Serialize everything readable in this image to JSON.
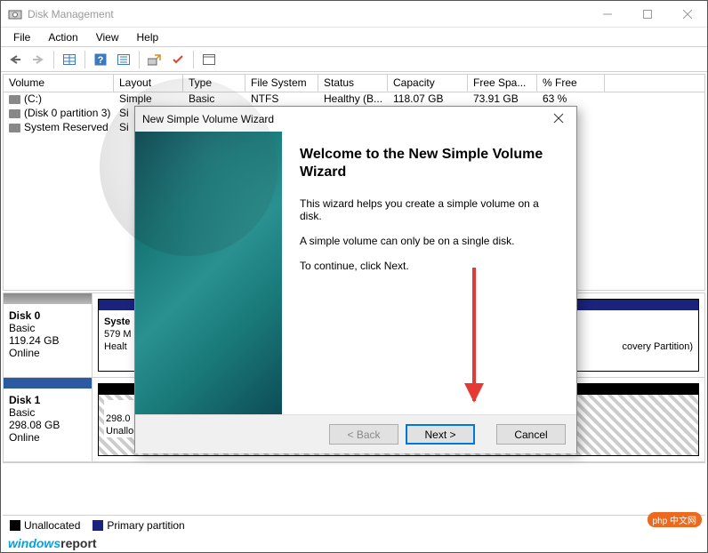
{
  "window": {
    "title": "Disk Management",
    "menus": [
      "File",
      "Action",
      "View",
      "Help"
    ]
  },
  "columns": {
    "volume": "Volume",
    "layout": "Layout",
    "type": "Type",
    "fs": "File System",
    "status": "Status",
    "capacity": "Capacity",
    "free": "Free Spa...",
    "pct": "% Free"
  },
  "volumes": [
    {
      "name": "(C:)",
      "layout": "Simple",
      "type": "Basic",
      "fs": "NTFS",
      "status": "Healthy (B...",
      "cap": "118.07 GB",
      "free": "73.91 GB",
      "pct": "63 %"
    },
    {
      "name": "(Disk 0 partition 3)",
      "layout": "Si",
      "type": "",
      "fs": "",
      "status": "",
      "cap": "",
      "free": "",
      "pct": ""
    },
    {
      "name": "System Reserved",
      "layout": "Si",
      "type": "",
      "fs": "",
      "status": "",
      "cap": "",
      "free": "",
      "pct": ""
    }
  ],
  "disks": [
    {
      "name": "Disk 0",
      "type": "Basic",
      "size": "119.24 GB",
      "state": "Online",
      "parts": [
        {
          "label1": "Syste",
          "label2": "579 M",
          "label3": "Healt"
        },
        {
          "label1": "",
          "label2": "",
          "label3": "covery Partition)"
        }
      ]
    },
    {
      "name": "Disk 1",
      "type": "Basic",
      "size": "298.08 GB",
      "state": "Online",
      "parts": [
        {
          "label1": "",
          "label2": "298.0",
          "label3": "Unallo"
        }
      ]
    }
  ],
  "legend": {
    "unallocated": "Unallocated",
    "primary": "Primary partition"
  },
  "wizard": {
    "title": "New Simple Volume Wizard",
    "heading": "Welcome to the New Simple Volume Wizard",
    "p1": "This wizard helps you create a simple volume on a disk.",
    "p2": "A simple volume can only be on a single disk.",
    "p3": "To continue, click Next.",
    "back": "< Back",
    "next": "Next >",
    "cancel": "Cancel"
  },
  "watermarks": {
    "left1": "windows",
    "left2": "report",
    "right": "php 中文网"
  }
}
